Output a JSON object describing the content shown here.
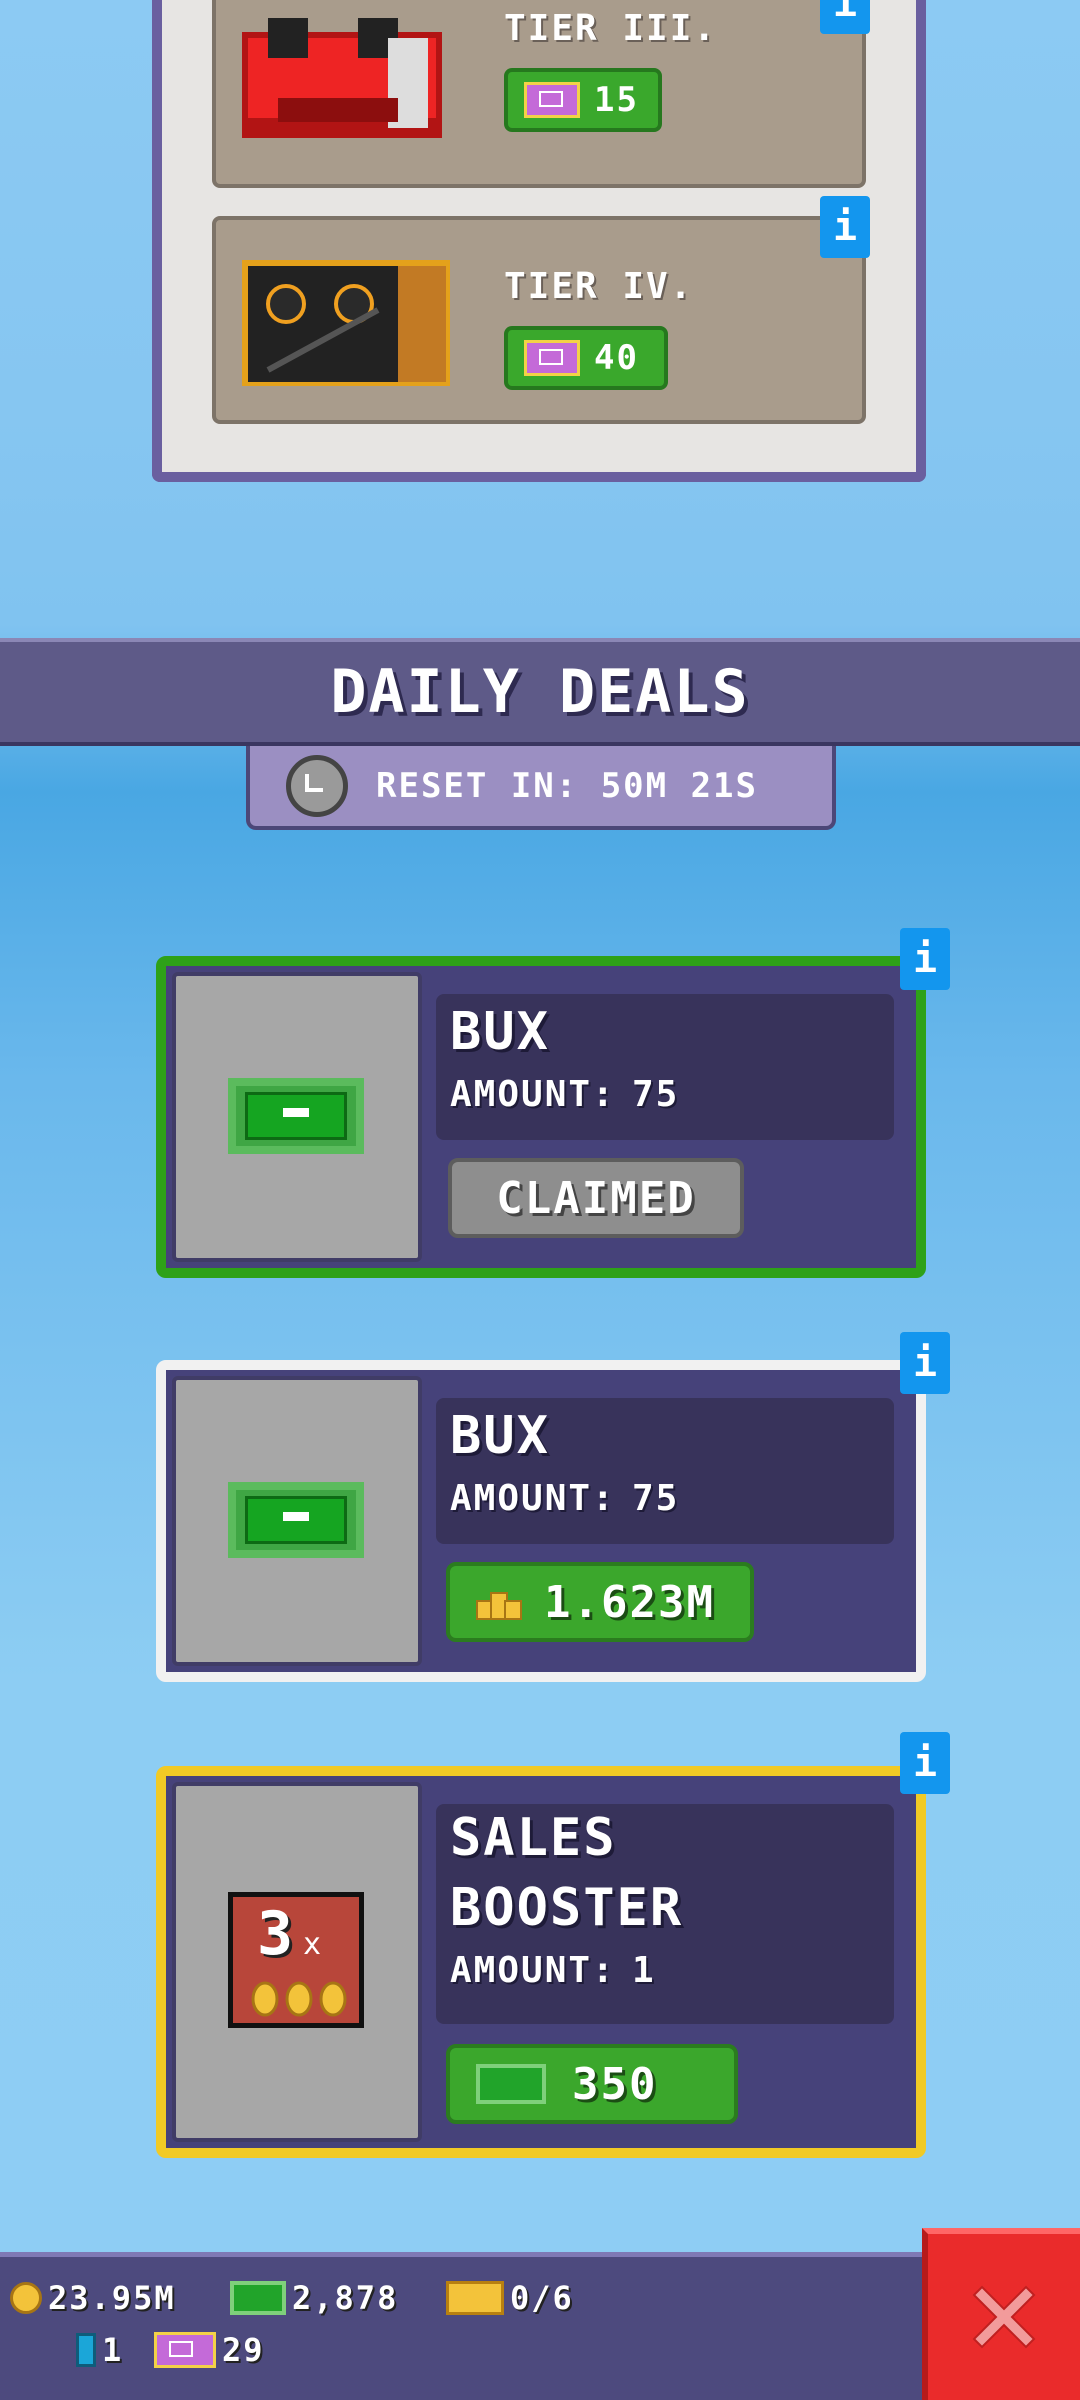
{
  "tiers": [
    {
      "label": "TIER III.",
      "price": "15"
    },
    {
      "label": "TIER IV.",
      "price": "40"
    }
  ],
  "deals_header": {
    "title": "DAILY DEALS",
    "reset_text": "RESET IN: 50M 21S"
  },
  "deals": [
    {
      "name": "BUX",
      "amount_label": "AMOUNT:",
      "amount_value": "75",
      "button": "CLAIMED"
    },
    {
      "name": "BUX",
      "amount_label": "AMOUNT:",
      "amount_value": "75",
      "button": "1.623M"
    },
    {
      "name_line1": "SALES",
      "name_line2": "BOOSTER",
      "amount_label": "AMOUNT:",
      "amount_value": "1",
      "button": "350",
      "booster_text": "3",
      "booster_x": "x"
    }
  ],
  "info_label": "i",
  "status": {
    "coins": "23.95M",
    "bux": "2,878",
    "cards": "0/6",
    "gems": "1",
    "tickets": "29"
  },
  "colors": {
    "accent_green": "#3aa82c",
    "border_green": "#2ea118",
    "border_gold": "#f1ca25",
    "close_red": "#ea2b2b",
    "panel_purple": "#46427a"
  }
}
